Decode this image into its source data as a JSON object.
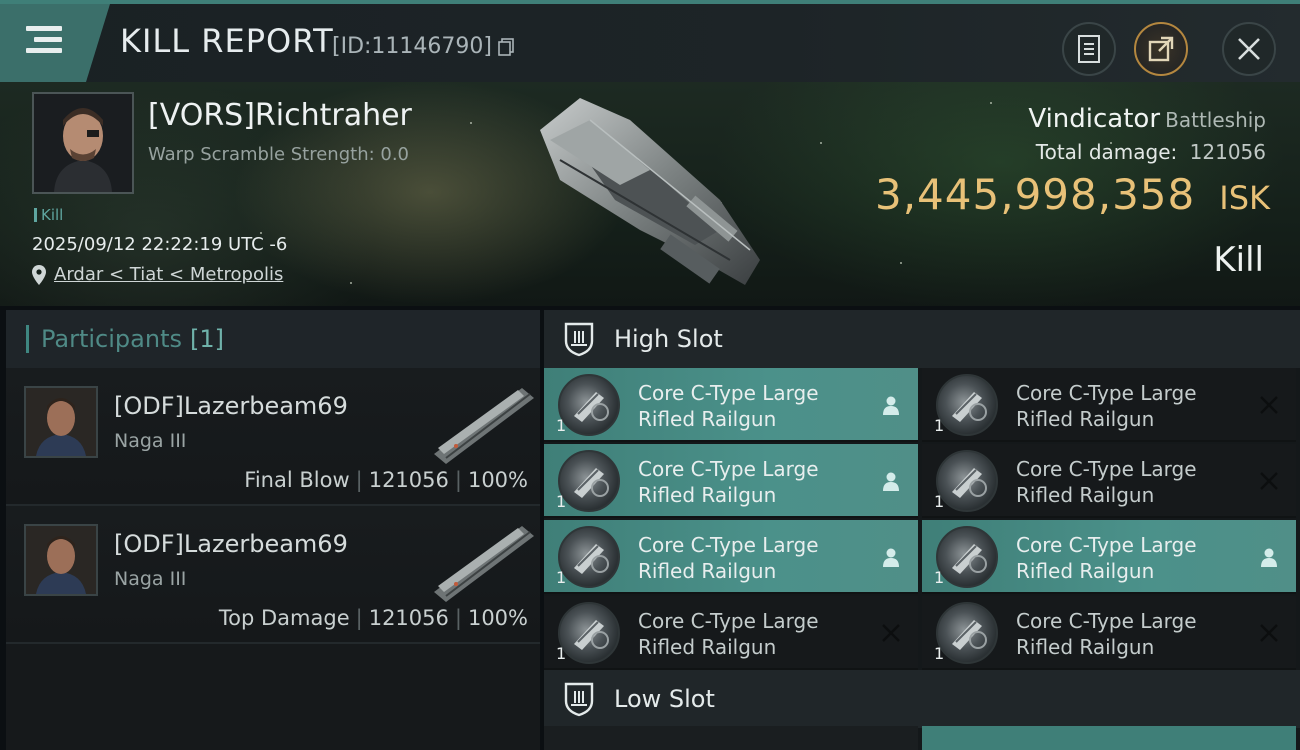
{
  "header": {
    "title": "KILL REPORT",
    "report_id": "[ID:11146790]",
    "menu_icon": "hamburger-menu-icon",
    "buttons": [
      "clipboard-icon",
      "share-icon",
      "close-icon"
    ]
  },
  "victim": {
    "name": "[VORS]Richtraher",
    "warp_scramble": "Warp Scramble Strength: 0.0",
    "tag": "Kill",
    "timestamp": "2025/09/12 22:22:19 UTC -6",
    "location": "Ardar < Tiat < Metropolis",
    "ship_name": "Vindicator",
    "ship_class": "Battleship",
    "total_damage_label": "Total damage:",
    "total_damage": "121056",
    "isk_value": "3,445,998,358",
    "isk_unit": "ISK",
    "result": "Kill"
  },
  "participants": {
    "label": "Participants",
    "count": "[1]",
    "rows": [
      {
        "name": "[ODF]Lazerbeam69",
        "ship": "Naga III",
        "role": "Final Blow",
        "damage": "121056",
        "percent": "100%"
      },
      {
        "name": "[ODF]Lazerbeam69",
        "ship": "Naga III",
        "role": "Top Damage",
        "damage": "121056",
        "percent": "100%"
      }
    ]
  },
  "slots": {
    "high_label": "High Slot",
    "low_label": "Low Slot",
    "high_modules": [
      {
        "line1": "Core C-Type Large",
        "line2": "Rifled Railgun",
        "qty": "1",
        "status": "fitted",
        "status_icon": "person-icon"
      },
      {
        "line1": "Core C-Type Large",
        "line2": "Rifled Railgun",
        "qty": "1",
        "status": "destroyed",
        "status_icon": "x-icon"
      },
      {
        "line1": "Core C-Type Large",
        "line2": "Rifled Railgun",
        "qty": "1",
        "status": "fitted",
        "status_icon": "person-icon"
      },
      {
        "line1": "Core C-Type Large",
        "line2": "Rifled Railgun",
        "qty": "1",
        "status": "destroyed",
        "status_icon": "x-icon"
      },
      {
        "line1": "Core C-Type Large",
        "line2": "Rifled Railgun",
        "qty": "1",
        "status": "fitted",
        "status_icon": "person-icon"
      },
      {
        "line1": "Core C-Type Large",
        "line2": "Rifled Railgun",
        "qty": "1",
        "status": "fitted",
        "status_icon": "person-icon"
      },
      {
        "line1": "Core C-Type Large",
        "line2": "Rifled Railgun",
        "qty": "1",
        "status": "destroyed",
        "status_icon": "x-icon"
      },
      {
        "line1": "Core C-Type Large",
        "line2": "Rifled Railgun",
        "qty": "1",
        "status": "destroyed",
        "status_icon": "x-icon"
      }
    ]
  },
  "colors": {
    "accent": "#3f7f78",
    "isk_gold": "#e8c178",
    "fitted_row": "#4b918a"
  }
}
